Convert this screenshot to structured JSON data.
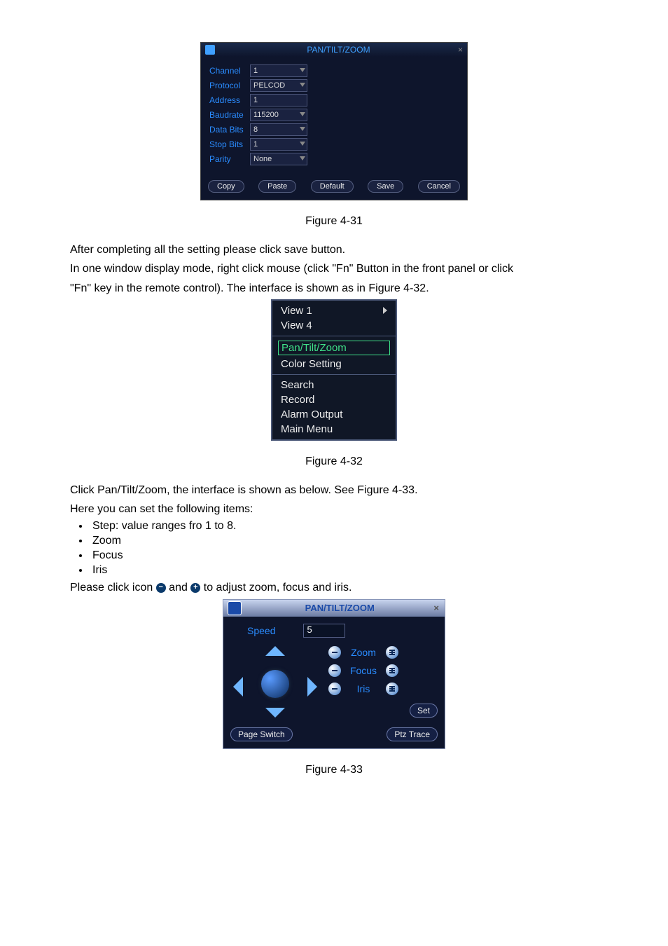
{
  "fig31": {
    "title": "PAN/TILT/ZOOM",
    "rows": {
      "channel": {
        "label": "Channel",
        "value": "1"
      },
      "protocol": {
        "label": "Protocol",
        "value": "PELCOD"
      },
      "address": {
        "label": "Address",
        "value": "1"
      },
      "baudrate": {
        "label": "Baudrate",
        "value": "115200"
      },
      "databits": {
        "label": "Data Bits",
        "value": "8"
      },
      "stopbits": {
        "label": "Stop Bits",
        "value": "1"
      },
      "parity": {
        "label": "Parity",
        "value": "None"
      }
    },
    "buttons": {
      "copy": "Copy",
      "paste": "Paste",
      "default": "Default",
      "save": "Save",
      "cancel": "Cancel"
    },
    "caption": "Figure 4-31"
  },
  "para1": {
    "l1": "After completing all the setting please click save button.",
    "l2": "In one window display mode, right click mouse (click \"Fn\" Button in the front panel or click",
    "l3": "\"Fn\" key in the remote control). The interface is shown as in Figure 4-32."
  },
  "fig32": {
    "view1": "View 1",
    "view4": "View 4",
    "ptz": "Pan/Tilt/Zoom",
    "color": "Color Setting",
    "search": "Search",
    "record": "Record",
    "alarm": "Alarm Output",
    "main": "Main Menu",
    "caption": "Figure 4-32"
  },
  "para2": {
    "l1": "Click Pan/Tilt/Zoom, the interface is shown as below. See Figure 4-33.",
    "l2": "Here you can set the following items:",
    "b1": "Step: value ranges fro 1 to 8.",
    "b2": "Zoom",
    "b3": "Focus",
    "b4": "Iris",
    "l3a": "Please click icon ",
    "l3b": " and ",
    "l3c": " to adjust zoom, focus and iris."
  },
  "fig33": {
    "title": "PAN/TILT/ZOOM",
    "speed_label": "Speed",
    "speed_value": "5",
    "zoom": "Zoom",
    "focus": "Focus",
    "iris": "Iris",
    "set": "Set",
    "page_switch": "Page Switch",
    "ptz_trace": "Ptz Trace",
    "caption": "Figure 4-33"
  }
}
